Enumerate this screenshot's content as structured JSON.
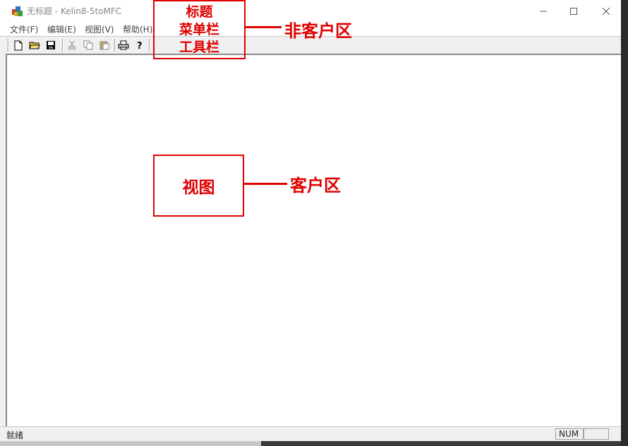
{
  "window": {
    "title": "无标题 - Kelin8-5toMFC",
    "minimize_icon": "minimize-icon",
    "maximize_icon": "maximize-icon",
    "close_icon": "close-icon"
  },
  "menubar": {
    "items": [
      "文件(F)",
      "编辑(E)",
      "视图(V)",
      "帮助(H)"
    ]
  },
  "toolbar": {
    "icons": [
      "new-file-icon",
      "open-folder-icon",
      "save-icon",
      "cut-icon",
      "copy-icon",
      "paste-icon",
      "print-icon",
      "help-icon"
    ]
  },
  "statusbar": {
    "text": "就绪",
    "num": "NUM"
  },
  "annotations": {
    "top_box_lines": [
      "标题",
      "菜单栏",
      "工具栏"
    ],
    "top_label": "非客户区",
    "view_box": "视图",
    "view_label": "客户区",
    "color": "#e00000"
  }
}
